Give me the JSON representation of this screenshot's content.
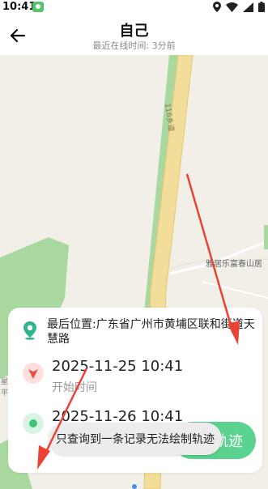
{
  "status_bar": {
    "time": "10:41"
  },
  "header": {
    "title": "自己",
    "subtitle": "最近在线时间: 3分前"
  },
  "map": {
    "road_label": "116乡道",
    "poi_label": "雅居乐富春山居",
    "edge_label_1": "星",
    "edge_label_2": "平"
  },
  "card": {
    "location": "最后位置:广东省广州市黄埔区联和街道天慧路",
    "start": {
      "time": "2025-11-25 10:41",
      "label": "开始时间"
    },
    "end": {
      "time": "2025-11-26 10:41"
    }
  },
  "track_button": {
    "label": "轨迹"
  },
  "toast": {
    "text": "只查询到一条记录无法绘制轨迹"
  },
  "colors": {
    "accent_green": "#5cd290",
    "start_red": "#e94b45",
    "end_green": "#3cc878",
    "location_teal": "#2fb391",
    "annotation_arrow": "#ea4335"
  }
}
